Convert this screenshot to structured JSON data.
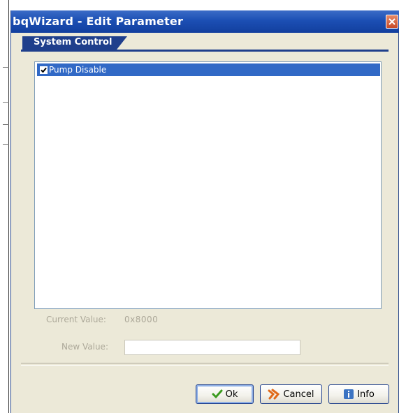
{
  "window": {
    "title": "bqWizard - Edit Parameter"
  },
  "tab": {
    "label": "System Control"
  },
  "list": {
    "items": [
      {
        "label": "Pump Disable",
        "checked": true,
        "selected": true
      }
    ]
  },
  "fields": {
    "current_value_label": "Current Value:",
    "current_value": "0x8000",
    "new_value_label": "New Value:",
    "new_value": ""
  },
  "buttons": {
    "ok_label": "Ok",
    "cancel_label": "Cancel",
    "info_label": "Info"
  },
  "icons": {
    "ok": "checkmark-icon",
    "cancel": "cancel-icon",
    "info": "info-icon",
    "close": "close-icon"
  },
  "colors": {
    "titlebar": "#1c4fb4",
    "tab": "#1f3f8c",
    "selection": "#3169c6",
    "window_bg": "#ece9d8"
  }
}
